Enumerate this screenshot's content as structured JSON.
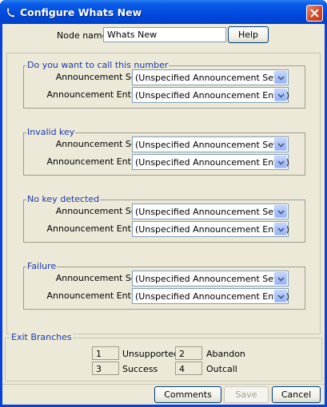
{
  "window": {
    "title": "Configure Whats New"
  },
  "node": {
    "label": "Node name",
    "value": "Whats New",
    "help_label": "Help"
  },
  "groups": [
    {
      "title": "Do you want to call this number",
      "set_label": "Announcement Set",
      "set_value": "(Unspecified Announcement Set)",
      "entry_label": "Announcement Entry",
      "entry_value": "(Unspecified Announcement Entry)"
    },
    {
      "title": "Invalid key",
      "set_label": "Announcement Set",
      "set_value": "(Unspecified Announcement Set)",
      "entry_label": "Announcement Entry",
      "entry_value": "(Unspecified Announcement Entry)"
    },
    {
      "title": "No key detected",
      "set_label": "Announcement Set",
      "set_value": "(Unspecified Announcement Set)",
      "entry_label": "Announcement Entry",
      "entry_value": "(Unspecified Announcement Entry)"
    },
    {
      "title": "Failure",
      "set_label": "Announcement Set",
      "set_value": "(Unspecified Announcement Set)",
      "entry_label": "Announcement Entry",
      "entry_value": "(Unspecified Announcement Entry)"
    }
  ],
  "exit_branches": {
    "title": "Exit Branches",
    "items": [
      {
        "num": "1",
        "name": "Unsupported"
      },
      {
        "num": "2",
        "name": "Abandon"
      },
      {
        "num": "3",
        "name": "Success"
      },
      {
        "num": "4",
        "name": "Outcall"
      }
    ]
  },
  "footer": {
    "comments_label": "Comments",
    "save_label": "Save",
    "cancel_label": "Cancel"
  }
}
